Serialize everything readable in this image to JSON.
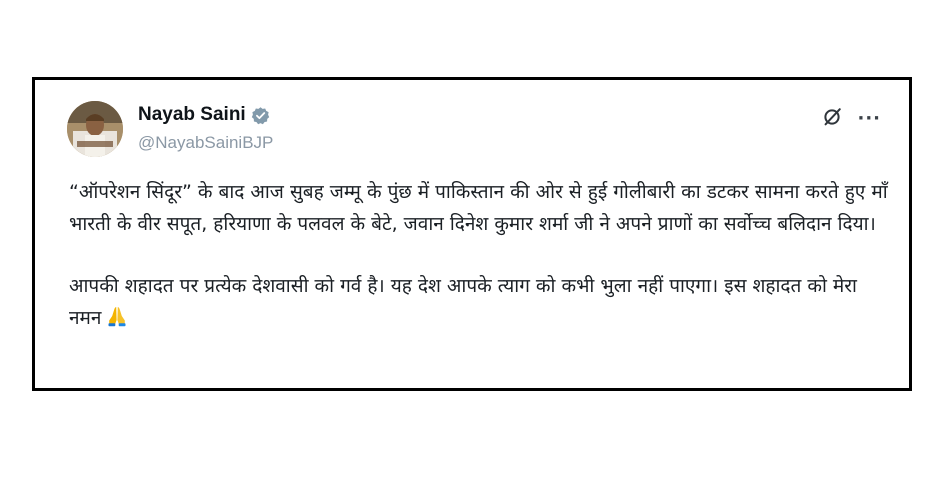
{
  "author": {
    "name": "Nayab Saini",
    "handle": "@NayabSainiBJP",
    "verified": true
  },
  "icons": {
    "verified": "verified-badge-icon",
    "grok": "grok-icon",
    "more": "more-options-icon",
    "emoji": "folded-hands-emoji"
  },
  "colors": {
    "verified_badge": "#829aab",
    "handle_text": "#8b98a5",
    "frame_border": "#000000"
  },
  "tweet": {
    "paragraph_1": "“ऑपरेशन सिंदूर” के बाद आज सुबह जम्मू के पुंछ में पाकिस्तान की ओर से हुई गोलीबारी का डटकर सामना करते हुए माँ भारती के वीर सपूत, हरियाणा के पलवल के बेटे, जवान दिनेश कुमार शर्मा जी ने अपने प्राणों का सर्वोच्च बलिदान दिया।",
    "paragraph_2": "आपकी शहादत पर प्रत्येक देशवासी को गर्व है। यह देश आपके त्याग को कभी भुला नहीं पाएगा। इस शहादत को मेरा नमन"
  },
  "more_label": "···"
}
